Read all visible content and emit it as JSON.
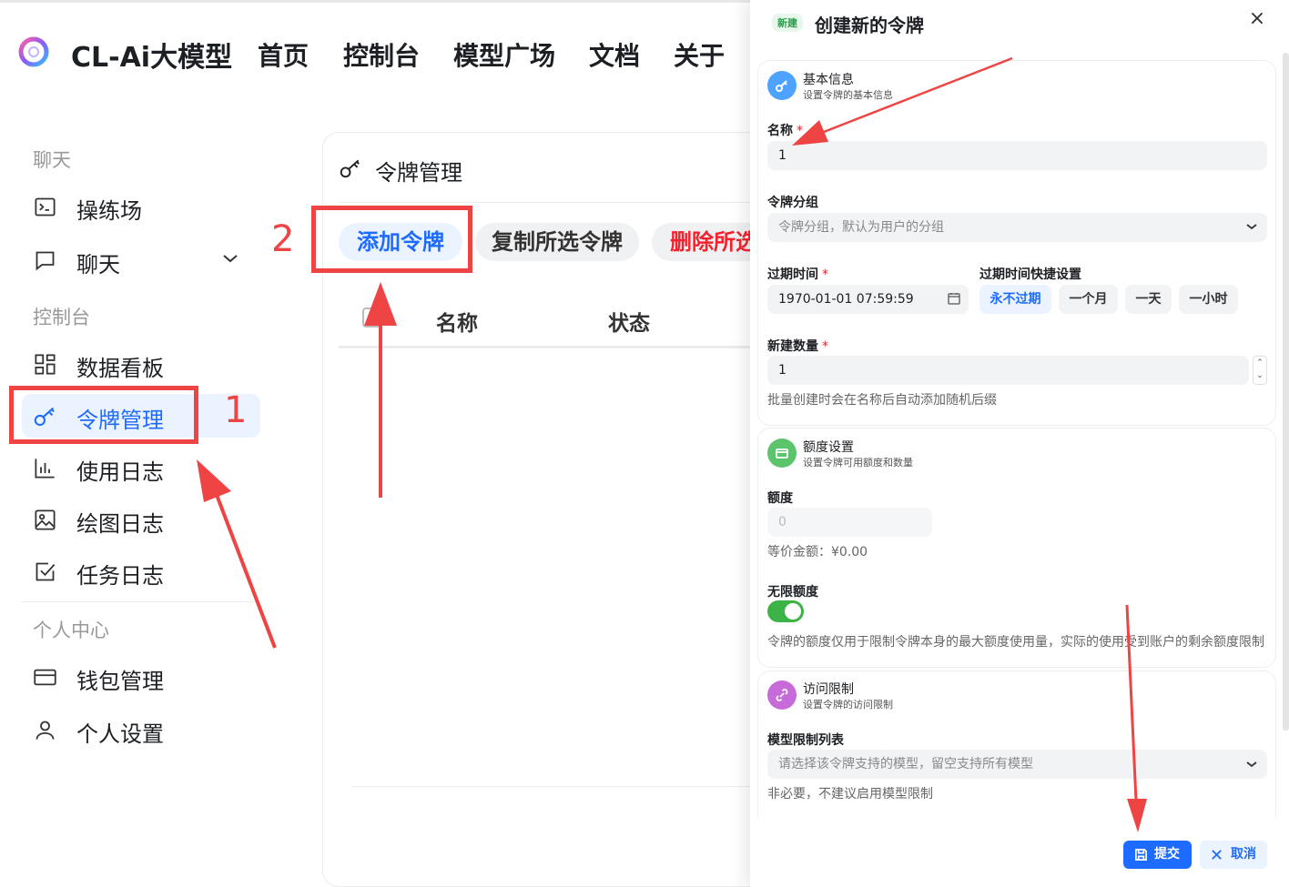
{
  "header": {
    "brand": "CL-Ai大模型",
    "nav": [
      "首页",
      "控制台",
      "模型广场",
      "文档",
      "关于"
    ]
  },
  "sidebar": {
    "sections": {
      "chat": "聊天",
      "console": "控制台",
      "personal": "个人中心"
    },
    "items": {
      "playground": "操练场",
      "chat": "聊天",
      "dashboard": "数据看板",
      "tokens": "令牌管理",
      "usage_log": "使用日志",
      "drawing_log": "绘图日志",
      "task_log": "任务日志",
      "wallet": "钱包管理",
      "settings": "个人设置"
    },
    "active": "tokens"
  },
  "main": {
    "title": "令牌管理",
    "buttons": {
      "add": "添加令牌",
      "copy": "复制所选令牌",
      "delete": "删除所选"
    },
    "columns": [
      "名称",
      "状态"
    ]
  },
  "annotations": {
    "step1": "1",
    "step2": "2",
    "color": "#ef4444"
  },
  "drawer": {
    "badge": "新建",
    "title": "创建新的令牌",
    "close": "×",
    "basic": {
      "title": "基本信息",
      "subtitle": "设置令牌的基本信息",
      "name_label": "名称",
      "name_value": "1",
      "group_label": "令牌分组",
      "group_placeholder": "令牌分组，默认为用户的分组",
      "expire_label": "过期时间",
      "expire_value": "1970-01-01 07:59:59",
      "quick_label": "过期时间快捷设置",
      "quick": [
        "永不过期",
        "一个月",
        "一天",
        "一小时"
      ],
      "count_label": "新建数量",
      "count_value": "1",
      "count_hint": "批量创建时会在名称后自动添加随机后缀"
    },
    "quota": {
      "title": "额度设置",
      "subtitle": "设置令牌可用额度和数量",
      "quota_label": "额度",
      "quota_placeholder": "0",
      "equiv": "等价金额：¥0.00",
      "unlimited_label": "无限额度",
      "unlimited_on": true,
      "unlimited_hint": "令牌的额度仅用于限制令牌本身的最大额度使用量，实际的使用受到账户的剩余额度限制"
    },
    "access": {
      "title": "访问限制",
      "subtitle": "设置令牌的访问限制",
      "models_label": "模型限制列表",
      "models_placeholder": "请选择该令牌支持的模型，留空支持所有模型",
      "models_hint": "非必要，不建议启用模型限制"
    },
    "footer": {
      "submit": "提交",
      "cancel": "取消"
    },
    "colors": {
      "primary": "#1e6bff",
      "success": "#3bb346"
    }
  }
}
